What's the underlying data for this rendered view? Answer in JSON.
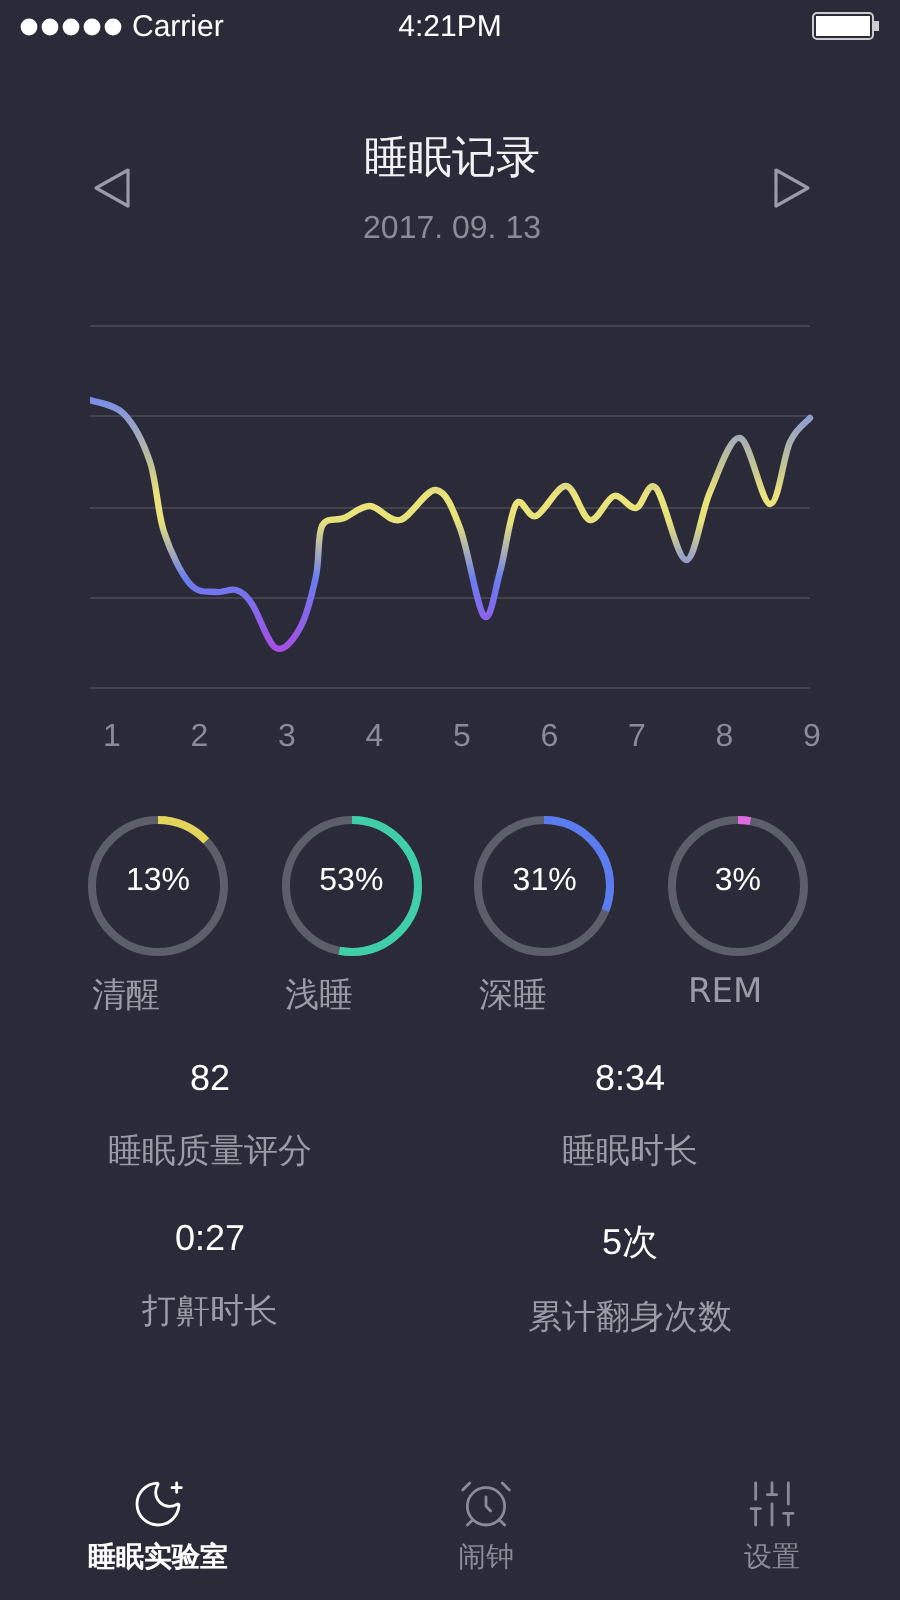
{
  "status_bar": {
    "carrier": "Carrier",
    "time": "4:21PM"
  },
  "header": {
    "title": "睡眠记录",
    "date": "2017. 09. 13"
  },
  "chart": {
    "x_labels": [
      "1",
      "2",
      "3",
      "4",
      "5",
      "6",
      "7",
      "8",
      "9"
    ]
  },
  "stages": [
    {
      "label": "清醒",
      "reading": "13%",
      "level": 0.13,
      "color": "#e3d45a"
    },
    {
      "label": "浅睡",
      "reading": "53%",
      "level": 0.53,
      "color": "#3fcfa8"
    },
    {
      "label": "深睡",
      "reading": "31%",
      "level": 0.31,
      "color": "#5a7cf0"
    },
    {
      "label": "REM",
      "reading": "3%",
      "level": 0.03,
      "color": "#e06ae0"
    }
  ],
  "stats": [
    {
      "value": "82",
      "label": "睡眠质量评分"
    },
    {
      "value": "8:34",
      "label": "睡眠时长"
    },
    {
      "value": "0:27",
      "label": "打鼾时长"
    },
    {
      "value": "5次",
      "label": "累计翻身次数"
    }
  ],
  "tabs": [
    {
      "label": "睡眠实验室",
      "selected": true
    },
    {
      "label": "闹钟",
      "selected": false
    },
    {
      "label": "设置",
      "selected": false
    }
  ]
}
